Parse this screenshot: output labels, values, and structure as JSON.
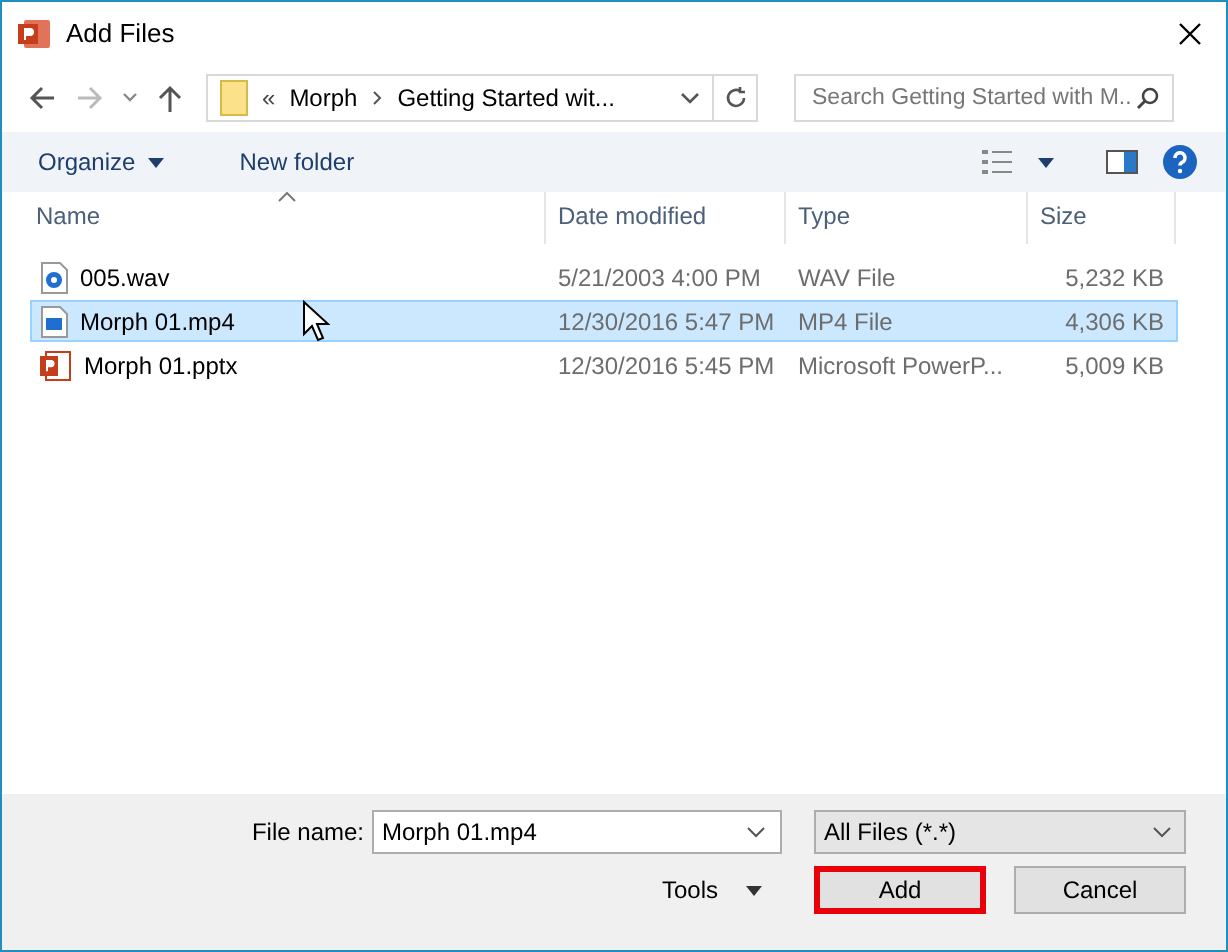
{
  "window": {
    "title": "Add Files"
  },
  "breadcrumb": {
    "overflow": "«",
    "segments": [
      "Morph",
      "Getting Started wit..."
    ]
  },
  "search": {
    "placeholder": "Search Getting Started with M..."
  },
  "toolbar": {
    "organize": "Organize",
    "new_folder": "New folder"
  },
  "table": {
    "columns": [
      "Name",
      "Date modified",
      "Type",
      "Size"
    ],
    "rows": [
      {
        "kind": "audio",
        "name": "005.wav",
        "date": "5/21/2003 4:00 PM",
        "type": "WAV File",
        "size": "5,232 KB",
        "selected": false
      },
      {
        "kind": "video",
        "name": "Morph 01.mp4",
        "date": "12/30/2016 5:47 PM",
        "type": "MP4 File",
        "size": "4,306 KB",
        "selected": true
      },
      {
        "kind": "presentation",
        "name": "Morph 01.pptx",
        "date": "12/30/2016 5:45 PM",
        "type": "Microsoft PowerP...",
        "size": "5,009 KB",
        "selected": false
      }
    ]
  },
  "file_name": {
    "label": "File name:",
    "value": "Morph 01.mp4"
  },
  "file_type": {
    "value": "All Files (*.*)"
  },
  "tools": "Tools",
  "buttons": [
    {
      "label": "Add",
      "highlighted": true
    },
    {
      "label": "Cancel",
      "highlighted": false
    }
  ]
}
